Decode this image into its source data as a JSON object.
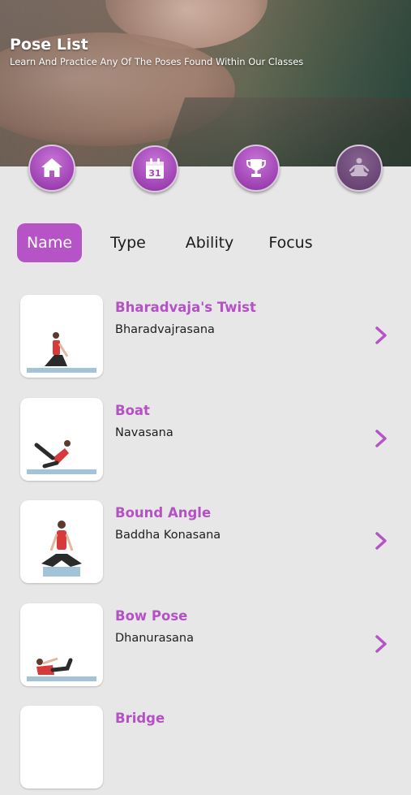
{
  "header": {
    "title": "Pose List",
    "subtitle": "Learn And Practice Any Of The Poses Found Within Our Classes"
  },
  "nav": [
    {
      "name": "home",
      "icon": "home-icon"
    },
    {
      "name": "schedule",
      "icon": "calendar-icon",
      "badge": "31"
    },
    {
      "name": "achievements",
      "icon": "trophy-icon"
    },
    {
      "name": "poses",
      "icon": "meditation-icon",
      "active": true
    }
  ],
  "filters": {
    "items": [
      "Name",
      "Type",
      "Ability",
      "Focus"
    ],
    "selected": "Name"
  },
  "poses": [
    {
      "name": "Bharadvaja's Twist",
      "sanskrit": "Bharadvajrasana"
    },
    {
      "name": "Boat",
      "sanskrit": "Navasana"
    },
    {
      "name": "Bound Angle",
      "sanskrit": "Baddha Konasana"
    },
    {
      "name": "Bow Pose",
      "sanskrit": "Dhanurasana"
    },
    {
      "name": "Bridge",
      "sanskrit": ""
    }
  ],
  "colors": {
    "accent": "#b653c7",
    "accent_text": "#b451c5",
    "background": "#e8e7e8",
    "nav_active": "#6a4675"
  }
}
